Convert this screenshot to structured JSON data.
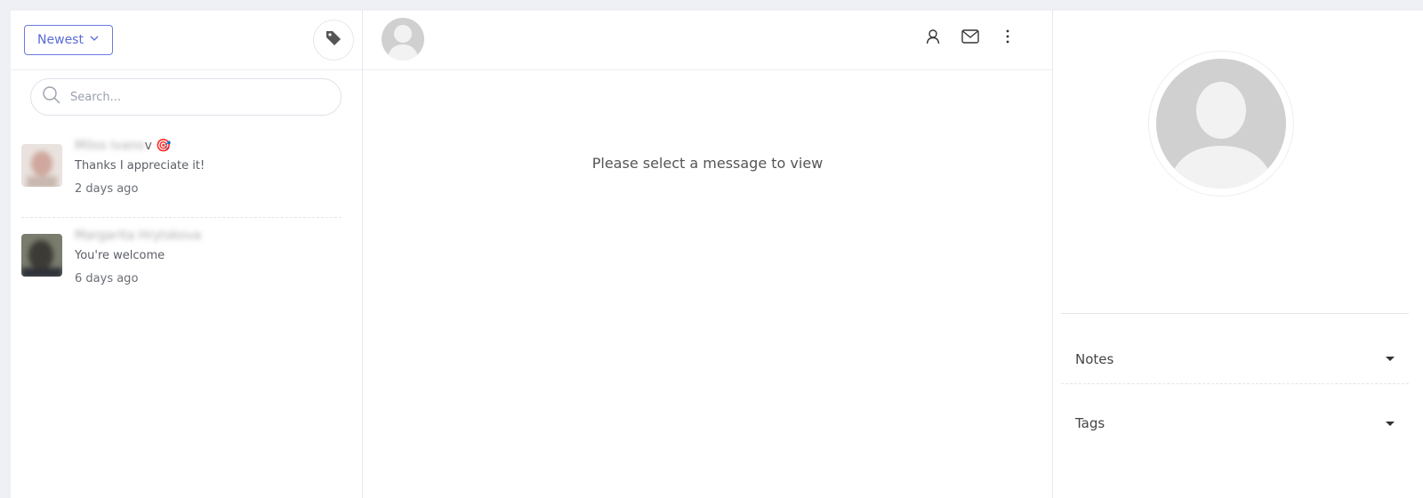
{
  "left": {
    "sort_label": "Newest",
    "search": {
      "placeholder": "Search..."
    },
    "conversations": [
      {
        "name_blurred": "Milos Ivano",
        "name_visible": "v",
        "emoji": "🎯",
        "preview": "Thanks I appreciate it!",
        "time": "2 days ago"
      },
      {
        "name_blurred": "Margarita Hrytskova",
        "name_visible": "",
        "emoji": "",
        "preview": "You're welcome",
        "time": "6 days ago"
      }
    ]
  },
  "middle": {
    "empty_message": "Please select a message to view"
  },
  "right": {
    "sections": [
      {
        "label": "Notes"
      },
      {
        "label": "Tags"
      }
    ]
  },
  "colors": {
    "accent": "#5b6bd6",
    "page_background": "#eef0f5",
    "avatar_placeholder": "#d0d0d0"
  },
  "icons": {
    "sort_chevron": "chevron-down-icon",
    "tag": "tag-icon",
    "search": "search-icon",
    "profile": "user-icon",
    "email": "mail-icon",
    "more": "more-vertical-icon",
    "caret": "caret-down-icon"
  }
}
